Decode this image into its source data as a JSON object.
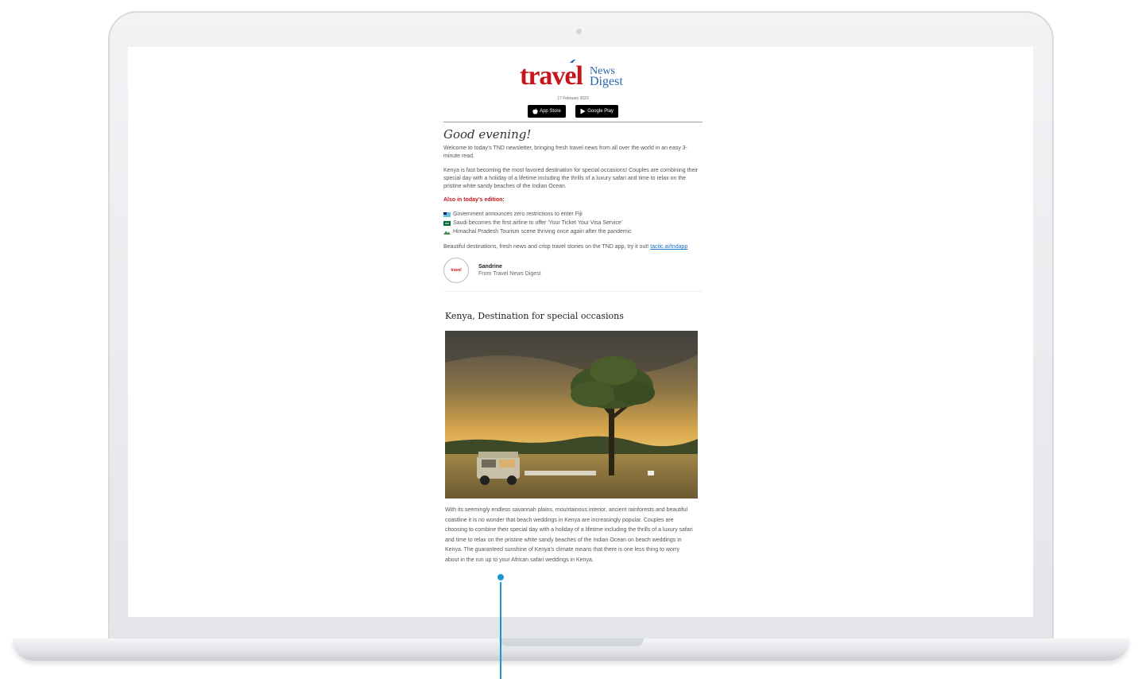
{
  "email": {
    "logo": {
      "word": "travel",
      "news": "News",
      "digest": "Digest"
    },
    "date": "17 February 2023",
    "store_buttons": [
      {
        "label": "App Store",
        "icon": "apple-icon"
      },
      {
        "label": "Google Play",
        "icon": "google-play-icon"
      }
    ],
    "greeting": "Good evening!",
    "intro": "Welcome to today's TND newsletter, bringing fresh travel news from all over the world in an easy 3-minute read.",
    "lead": "Kenya is fast becoming the most favored destination for special occasions! Couples are combining their special day with a holiday of a lifetime including the thrills of a luxury safari and time to relax on the pristine white sandy beaches of the Indian Ocean.",
    "also_heading": "Also in today's edition:",
    "bullets": [
      {
        "icon": "fiji-flag-icon",
        "text": "Government announces zero restrictions to enter Fiji"
      },
      {
        "icon": "saudi-flag-icon",
        "text": "Saudi becomes the first airline to offer 'Your Ticket Your Visa Service'"
      },
      {
        "icon": "mountain-icon",
        "text": "Himachal Pradesh Tourism scene thriving once again after the pandemic"
      }
    ],
    "app_promo": "Beautiful destinations, fresh news and crisp travel stories on the TND app, try it out!",
    "app_link": "tactic.ai/tndapp",
    "signoff": {
      "avatar_text": "travel",
      "name": "Sandrine",
      "from": "From Travel News Digest"
    },
    "article": {
      "title": "Kenya, Destination for special occasions",
      "body": "With its seemingly endless savannah plains, mountainous interior, ancient rainforests and beautiful coastline it is no wonder that beach weddings in Kenya are increasingly popular. Couples are choosing to combine their special day with a holiday of a lifetime including the thrills of a luxury safari and time to relax on the pristine white sandy beaches of the Indian Ocean on beach weddings in Kenya. The guaranteed sunshine of Kenya's climate means that there is one less thing to worry about in the run up to your African safari weddings in Kenya."
    }
  },
  "colors": {
    "brand_red": "#c4161c",
    "brand_blue": "#2b66ae",
    "link_blue": "#1a73c9",
    "pointer_blue": "#1a96d4"
  }
}
